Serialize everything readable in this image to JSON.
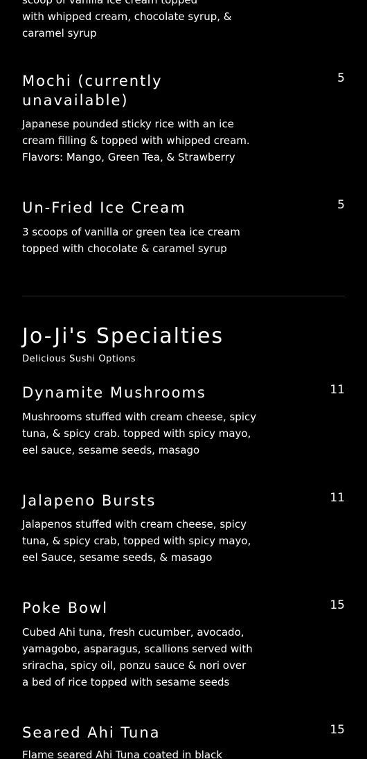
{
  "colors": {
    "background": "#000000",
    "text": "#ffffff",
    "divider": "#2a2a2a"
  },
  "top_fragment": {
    "lines": [
      "scoop of vanilla ice cream topped",
      "with whipped cream, chocolate syrup, &",
      "caramel syrup"
    ]
  },
  "desserts": {
    "items": [
      {
        "name": "Mochi (currently unavailable)",
        "price": "5",
        "description": "Japanese pounded sticky rice with an ice cream filling & topped with whipped cream. Flavors: Mango, Green Tea, & Strawberry"
      },
      {
        "name": "Un-Fried Ice Cream",
        "price": "5",
        "description": "3 scoops of  vanilla or green tea ice cream topped with chocolate & caramel syrup"
      }
    ]
  },
  "specialties": {
    "title": "Jo-Ji's Specialties",
    "subtitle": "Delicious Sushi Options",
    "items": [
      {
        "name": "Dynamite Mushrooms",
        "price": "11",
        "description": "Mushrooms stuffed with cream cheese, spicy tuna, & spicy crab. topped with spicy mayo, eel sauce, sesame seeds, masago"
      },
      {
        "name": "Jalapeno Bursts",
        "price": "11",
        "description": "Jalapenos stuffed with cream cheese, spicy tuna, & spicy crab, topped with spicy mayo, eel Sauce, sesame seeds, & masago"
      },
      {
        "name": "Poke Bowl",
        "price": "15",
        "description": "Cubed Ahi tuna, fresh cucumber, avocado, yamagobo, asparagus, scallions served with sriracha, spicy oil, ponzu sauce & nori over a bed of rice topped with sesame seeds"
      },
      {
        "name": "Seared Ahi Tuna",
        "price": "15",
        "description": "Flame seared Ahi Tuna coated in black"
      }
    ]
  }
}
